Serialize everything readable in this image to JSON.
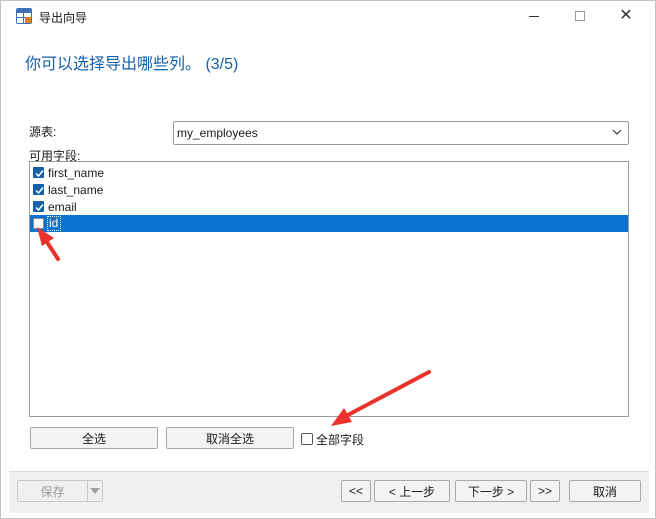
{
  "window": {
    "title": "导出向导"
  },
  "heading": "你可以选择导出哪些列。 (3/5)",
  "source": {
    "label": "源表:",
    "value": "my_employees"
  },
  "fields": {
    "label": "可用字段:",
    "items": [
      {
        "name": "first_name",
        "checked": true,
        "selected": false
      },
      {
        "name": "last_name",
        "checked": true,
        "selected": false
      },
      {
        "name": "email",
        "checked": true,
        "selected": false
      },
      {
        "name": "id",
        "checked": false,
        "selected": true
      }
    ]
  },
  "actions": {
    "select_all": "全选",
    "deselect_all": "取消全选",
    "all_fields": "全部字段"
  },
  "footer": {
    "save": "保存",
    "first": "<<",
    "prev": "< 上一步",
    "next": "下一步 >",
    "last": ">>",
    "cancel": "取消"
  },
  "colors": {
    "accent": "#1560ad",
    "selection": "#0a72d2",
    "annotation": "#e8322b"
  }
}
